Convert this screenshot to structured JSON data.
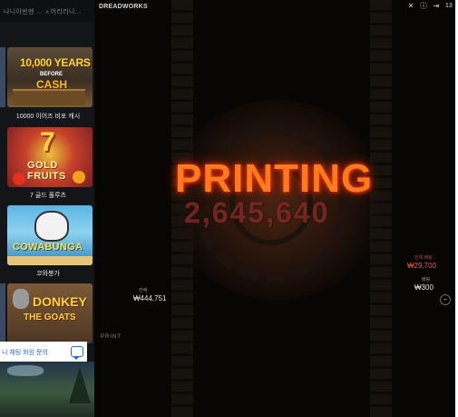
{
  "sidebar": {
    "header_text": "나니아빈맨  ...  ㅅ어리리니...",
    "games": [
      {
        "art_line1": "10,000 YEARS",
        "art_line2": "BEFORE",
        "art_line3": "CASH",
        "title": "10000 이어즈 비포 캐시"
      },
      {
        "art_line1": "7",
        "art_line2": "GOLD FRUITS",
        "title": "7 골드 풀루츠"
      },
      {
        "art_line1": "COWABUNGA",
        "title": "코와붕가"
      },
      {
        "art_line1": "DONKEY",
        "art_line2": "THE GOATS",
        "title": ""
      }
    ],
    "chat_text": "니 채팅 화원 문의"
  },
  "game": {
    "provider": "DREADWORKS",
    "time": "13",
    "status_word": "PRINTING",
    "amount": "2,645,640",
    "balance_label": "잔액",
    "balance_value": "₩444,751",
    "win_label": "전체 배팅",
    "win_value": "₩29,700",
    "bet_label": "배팅",
    "bet_value": "₩300",
    "print_label": "PRINT"
  },
  "colors": {
    "accent_orange": "#ff7a1e",
    "amount_red": "#7a2a26",
    "win_red": "#e05a48",
    "chat_blue": "#2a6bd8"
  }
}
